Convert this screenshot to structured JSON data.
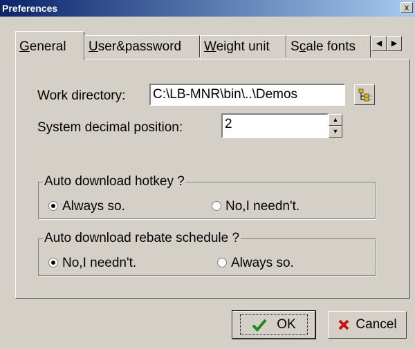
{
  "window": {
    "title": "Preferences",
    "close_symbol": "x"
  },
  "tabs": [
    {
      "pre": "",
      "u": "G",
      "post": "eneral",
      "active": true
    },
    {
      "pre": "",
      "u": "U",
      "post": "ser&password"
    },
    {
      "pre": "",
      "u": "W",
      "post": "eight unit"
    },
    {
      "pre": "S",
      "u": "c",
      "post": "ale fonts"
    }
  ],
  "work_directory": {
    "label": "Work directory:",
    "value": "C:\\LB-MNR\\bin\\..\\Demos"
  },
  "system_decimal": {
    "label": "System decimal position:",
    "value": "2"
  },
  "group_hotkey": {
    "legend": "Auto download hotkey ?",
    "option_a": "Always so.",
    "option_b": "No,I needn't.",
    "selected": "a"
  },
  "group_rebate": {
    "legend": "Auto download rebate schedule ?",
    "option_a": "No,I needn't.",
    "option_b": "Always so.",
    "selected": "a"
  },
  "buttons": {
    "ok": "OK",
    "cancel": "Cancel"
  },
  "icons": {
    "ok": "green-check-icon",
    "cancel": "red-x-icon",
    "browse": "folder-tree-icon"
  }
}
